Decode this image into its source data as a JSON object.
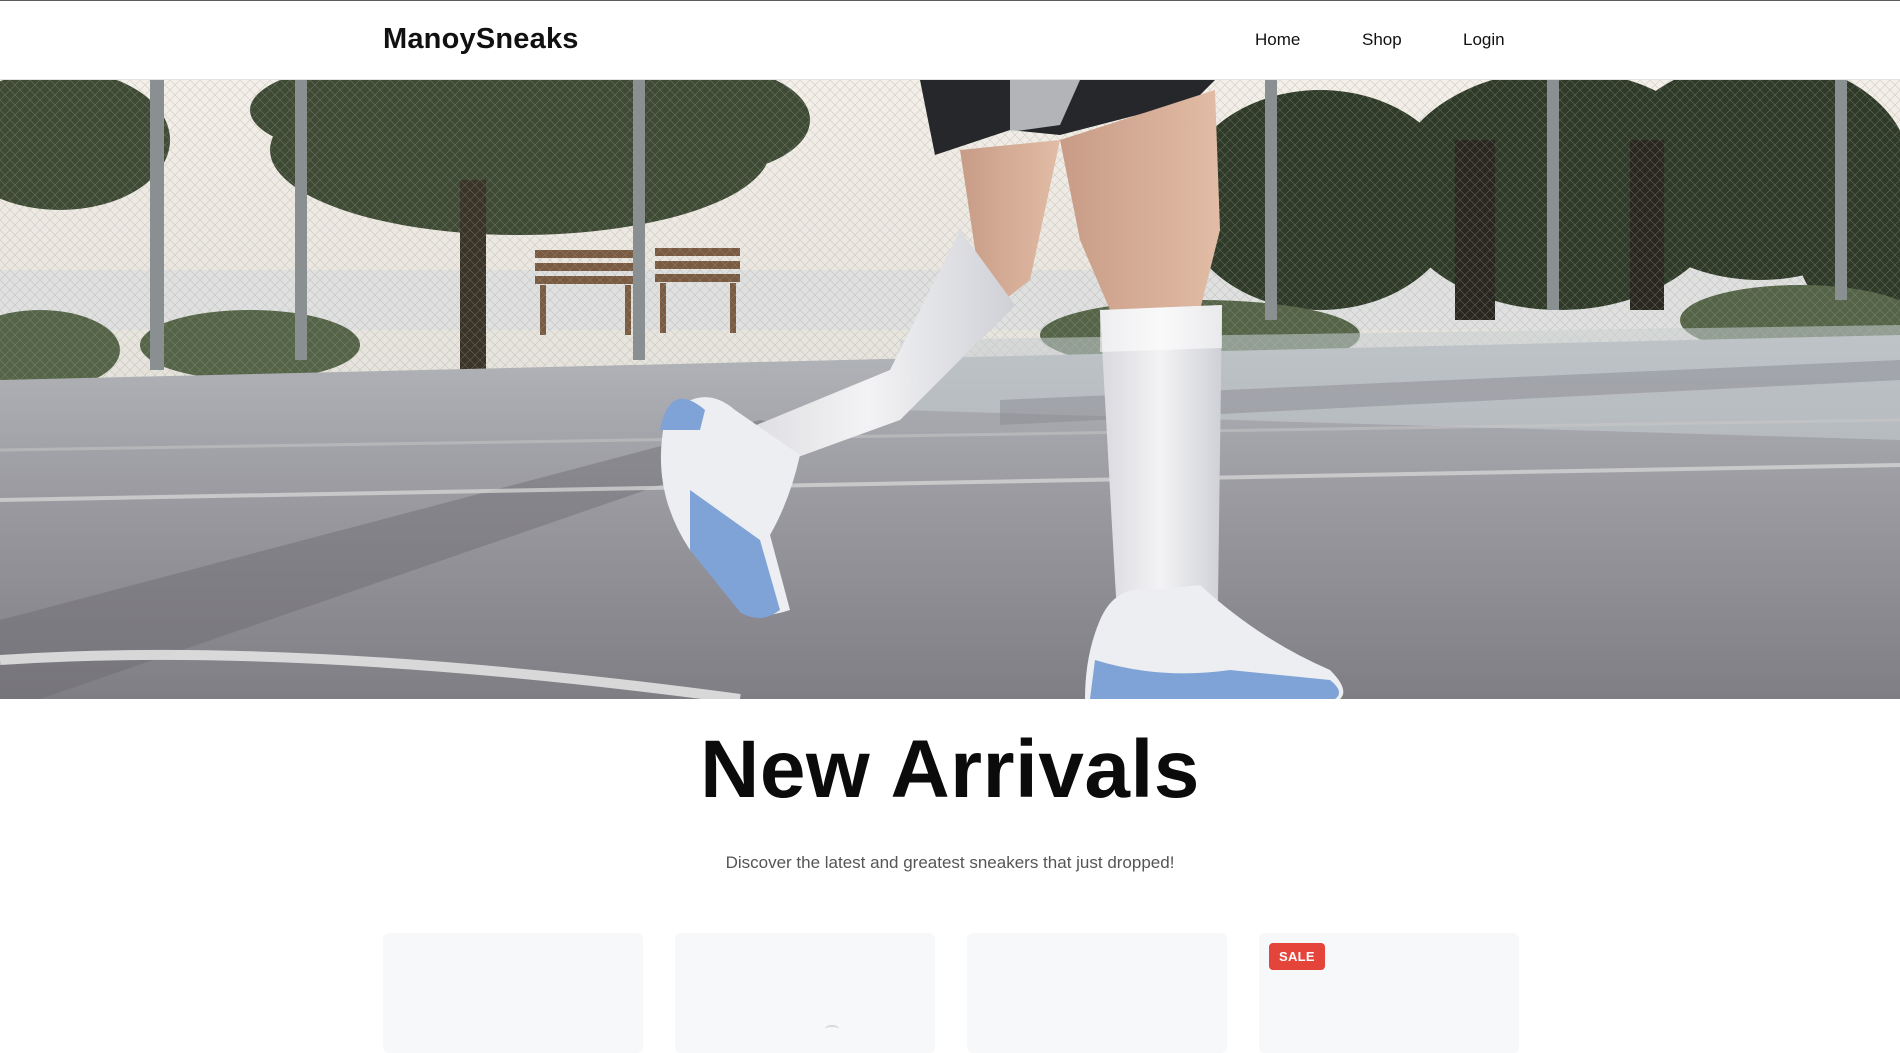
{
  "header": {
    "brand": "ManoySneaks",
    "nav": {
      "home": "Home",
      "shop": "Shop",
      "login": "Login"
    }
  },
  "hero": {
    "image": "sneakers-walking-hero-image"
  },
  "new_arrivals": {
    "title": "New Arrivals",
    "subtitle": "Discover the latest and greatest sneakers that just dropped!",
    "cards": [
      {
        "badge": ""
      },
      {
        "badge": ""
      },
      {
        "badge": ""
      },
      {
        "badge": "SALE"
      }
    ]
  },
  "colors": {
    "sale_badge": "#e5443a",
    "card_background": "#f7f8f9",
    "text_primary": "#111111",
    "text_muted": "#555555"
  }
}
